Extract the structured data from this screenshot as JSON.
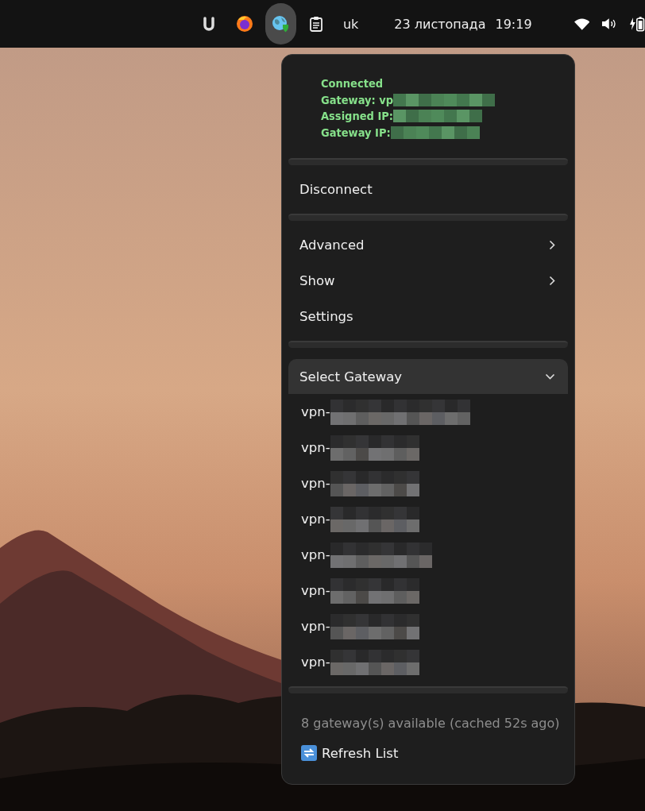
{
  "top_bar": {
    "tray": [
      {
        "kind": "j-logo",
        "selected": false
      },
      {
        "kind": "browser",
        "selected": false
      },
      {
        "kind": "vpn-globe",
        "selected": true
      },
      {
        "kind": "clipboard",
        "selected": false
      }
    ],
    "keyboard_layout": "uk",
    "date": "23 листопада",
    "time": "19:19"
  },
  "menu": {
    "status": [
      "Connected",
      "Gateway: vp",
      "Assigned IP:",
      "Gateway IP:"
    ],
    "actions": [
      {
        "label": "Disconnect"
      }
    ],
    "items": [
      {
        "label": "Advanced",
        "kind": "submenu"
      },
      {
        "label": "Show",
        "kind": "submenu"
      },
      {
        "label": "Settings",
        "kind": "item"
      }
    ],
    "gateway_section": {
      "label": "Select Gateway",
      "expanded": true,
      "gateways": [
        "vpn-",
        "vpn-",
        "vpn-",
        "vpn-",
        "vpn-",
        "vpn-",
        "vpn-",
        "vpn-"
      ]
    },
    "footer": {
      "summary": "8 gateway(s) available (cached 52s ago)",
      "refresh": "Refresh List"
    }
  }
}
